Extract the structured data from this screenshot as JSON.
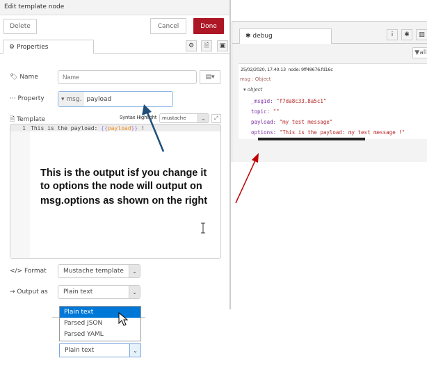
{
  "editor": {
    "title": "Edit template node",
    "delete_label": "Delete",
    "cancel_label": "Cancel",
    "done_label": "Done",
    "tab_properties": "Properties",
    "name_label": "Name",
    "name_placeholder": "Name",
    "property_label": "Property",
    "property_prefix": "msg.",
    "property_value": "payload",
    "template_label": "Template",
    "syntax_label": "Syntax Highlight",
    "syntax_value": "mustache",
    "line_number": "1",
    "code": {
      "pre": "This is the payload: ",
      "open": "{{",
      "var": "payload",
      "close": "}}",
      "post": " !"
    },
    "format_label": "Format",
    "format_value": "Mustache template",
    "output_label": "Output as",
    "output_value": "Plain text",
    "output_options": [
      "Plain text",
      "Parsed JSON",
      "Parsed YAML"
    ],
    "output_value_below": "Plain text"
  },
  "annotation": {
    "text_lines": [
      "This is the output isf you change it",
      "to options the node will output on",
      "msg.options as shown on the right"
    ]
  },
  "debug": {
    "tab_label": "debug",
    "filter_label": "all",
    "timestamp": "25/02/2020, 17:40:13",
    "node": "node: 9ff48676.fd16c",
    "msg_type": "msg : Object",
    "object_label": "object",
    "props": [
      {
        "key": "_msgid",
        "value": "\"f7da8c33.8a5c1\""
      },
      {
        "key": "topic",
        "value": "\"\""
      },
      {
        "key": "payload",
        "value": "\"my test message\""
      },
      {
        "key": "options",
        "value": "\"This is the payload: my test message !\""
      }
    ]
  },
  "colors": {
    "done": "#ad1625",
    "dropdown_selected": "#0078d7",
    "blue_arrow": "#1f4e79",
    "red_arrow": "#c00000"
  }
}
